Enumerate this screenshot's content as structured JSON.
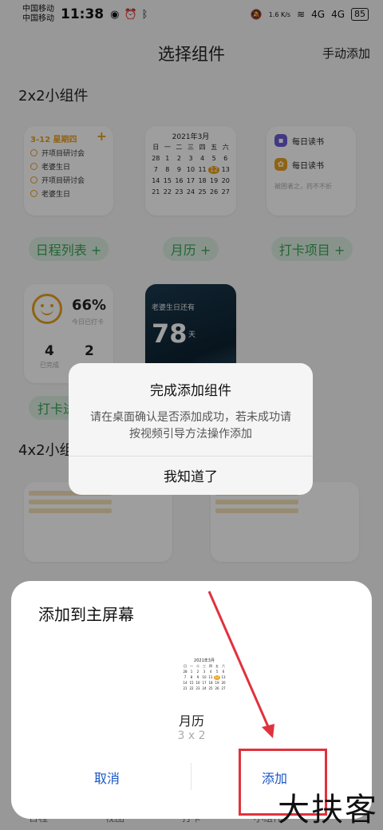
{
  "status_bar": {
    "carrier_1": "中国移动",
    "carrier_2": "中国移动",
    "time": "11:38",
    "net_speed": "1.6 K/s",
    "signal_1": "4G",
    "signal_2": "4G",
    "battery": "85"
  },
  "header": {
    "title": "选择组件",
    "manual_add": "手动添加"
  },
  "sections": {
    "small": "2x2小组件",
    "wide": "4x2小组"
  },
  "schedule_widget": {
    "date": "3-12 星期四",
    "items": [
      "开项目研讨会",
      "老婆生日",
      "开项目研讨会",
      "老婆生日"
    ]
  },
  "calendar_widget": {
    "title": "2021年3月",
    "weekdays": [
      "日",
      "一",
      "二",
      "三",
      "四",
      "五",
      "六"
    ],
    "days": [
      "28",
      "1",
      "2",
      "3",
      "4",
      "5",
      "6",
      "7",
      "8",
      "9",
      "10",
      "11",
      "12",
      "13",
      "14",
      "15",
      "16",
      "17",
      "18",
      "19",
      "20",
      "21",
      "22",
      "23",
      "24",
      "25",
      "26",
      "27"
    ],
    "today": "12"
  },
  "reading_widget": {
    "items": [
      "每日读书",
      "每日读书"
    ],
    "quote": "被困者之，药不不折"
  },
  "pills": {
    "schedule": "日程列表 +",
    "calendar": "月历 +",
    "checkin_item": "打卡项目 +",
    "checkin": "打卡进"
  },
  "checkin_widget": {
    "percent": "66%",
    "label": "今日已打卡",
    "done": "4",
    "done_label": "已完成",
    "total": "2"
  },
  "countdown_widget": {
    "label": "老婆生日还有",
    "number": "78",
    "unit": "天"
  },
  "dialog": {
    "title": "完成添加组件",
    "body": "请在桌面确认是否添加成功，若未成功请按视频引导方法操作添加",
    "confirm": "我知道了"
  },
  "sheet": {
    "title": "添加到主屏幕",
    "widget_name": "月历",
    "widget_size": "3 x 2",
    "cancel": "取消",
    "add": "添加"
  },
  "bottom_tabs": [
    "日程",
    "视图",
    "打卡",
    "小组件",
    ""
  ],
  "watermark": "大扶客",
  "colors": {
    "accent": "#e8a020",
    "link": "#1a56c4",
    "highlight": "#e0323d",
    "pill_text": "#3aa35a"
  }
}
